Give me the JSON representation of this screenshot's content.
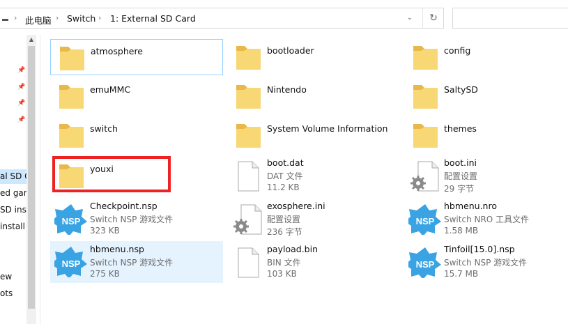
{
  "address_bar": {
    "breadcrumbs": [
      "此电脑",
      "Switch",
      "1: External SD Card"
    ],
    "separator": "›",
    "dropdown_glyph": "⌄",
    "refresh_glyph": "↻"
  },
  "search": {
    "placeholder": ""
  },
  "nav_pane": {
    "items": [
      {
        "label": "al SD C",
        "selected": true
      },
      {
        "label": "ed gam"
      },
      {
        "label": "SD inst"
      },
      {
        "label": " install"
      },
      {
        "label": "ew"
      },
      {
        "label": "ots"
      }
    ],
    "pin_glyph": "📌"
  },
  "files": [
    {
      "name": "atmosphere",
      "type": "folder"
    },
    {
      "name": "bootloader",
      "type": "folder"
    },
    {
      "name": "config",
      "type": "folder"
    },
    {
      "name": "emuMMC",
      "type": "folder"
    },
    {
      "name": "Nintendo",
      "type": "folder"
    },
    {
      "name": "SaltySD",
      "type": "folder"
    },
    {
      "name": "switch",
      "type": "folder"
    },
    {
      "name": "System Volume Information",
      "type": "folder"
    },
    {
      "name": "themes",
      "type": "folder"
    },
    {
      "name": "youxi",
      "type": "folder",
      "highlighted": true
    },
    {
      "name": "boot.dat",
      "type": "file",
      "kind": "DAT 文件",
      "size": "11.2 KB"
    },
    {
      "name": "boot.ini",
      "type": "settings",
      "kind": "配置设置",
      "size": "29 字节"
    },
    {
      "name": "Checkpoint.nsp",
      "type": "nsp",
      "kind": "Switch NSP 游戏文件",
      "size": "323 KB"
    },
    {
      "name": "exosphere.ini",
      "type": "settings",
      "kind": "配置设置",
      "size": "236 字节"
    },
    {
      "name": "hbmenu.nro",
      "type": "nsp",
      "kind": "Switch NRO 工具文件",
      "size": "1.58 MB"
    },
    {
      "name": "hbmenu.nsp",
      "type": "nsp",
      "kind": "Switch NSP 游戏文件",
      "size": "275 KB"
    },
    {
      "name": "payload.bin",
      "type": "file",
      "kind": "BIN 文件",
      "size": "103 KB"
    },
    {
      "name": "Tinfoil[15.0].nsp",
      "type": "nsp",
      "kind": "Switch NSP 游戏文件",
      "size": "15.7 MB"
    }
  ],
  "nsp_icon_text": "NSP",
  "colors": {
    "folder": "#f8d775",
    "folder_dark": "#e9b84a",
    "nsp_blue": "#3aa3e3",
    "selection": "#e5f3ff",
    "highlight_box": "#ee2222"
  }
}
